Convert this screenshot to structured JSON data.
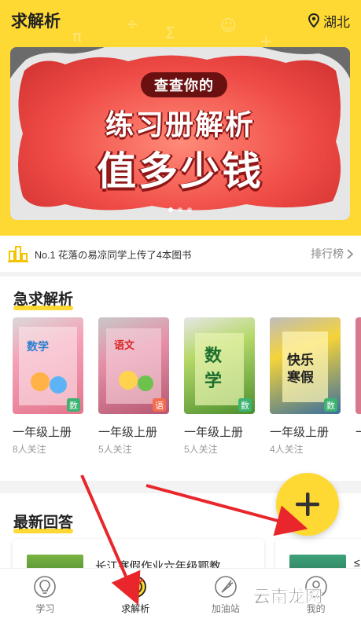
{
  "header": {
    "title": "求解析",
    "location": "湖北"
  },
  "banner": {
    "pill": "查查你的",
    "line1": "练习册解析",
    "line2": "值多少钱",
    "dots": 3,
    "active_dot": 0
  },
  "notice": {
    "message": "No.1 花落の易凉同学上传了4本图书",
    "rank_label": "排行榜"
  },
  "urgent": {
    "title": "急求解析",
    "cards": [
      {
        "grade": "一年级上册",
        "follow": "8人关注",
        "subject": "数",
        "subject_color": "#3cb371",
        "cover": "#f4a3b8"
      },
      {
        "grade": "一年级上册",
        "follow": "5人关注",
        "subject": "语",
        "subject_color": "#f26c4f",
        "cover": "#e58fa7"
      },
      {
        "grade": "一年级上册",
        "follow": "5人关注",
        "subject": "数",
        "subject_color": "#3cb371",
        "cover": "#8ac34a"
      },
      {
        "grade": "一年级上册",
        "follow": "4人关注",
        "subject": "数",
        "subject_color": "#3cb371",
        "cover": "#f5d33a"
      }
    ],
    "extra_grade": "一"
  },
  "latest": {
    "title": "最新回答",
    "answers": [
      {
        "title": "长江寒假作业六年级鄂教"
      }
    ],
    "extra_title": "≤"
  },
  "nav": {
    "items": [
      {
        "label": "学习",
        "icon": "lightbulb-icon"
      },
      {
        "label": "求解析",
        "icon": "target-icon"
      },
      {
        "label": "加油站",
        "icon": "carrot-icon"
      },
      {
        "label": "我的",
        "icon": "profile-icon"
      }
    ],
    "active": 1
  },
  "watermark": {
    "text": "云南龙网"
  },
  "colors": {
    "accent": "#ffd933",
    "annotation_arrow": "#e8262b"
  }
}
